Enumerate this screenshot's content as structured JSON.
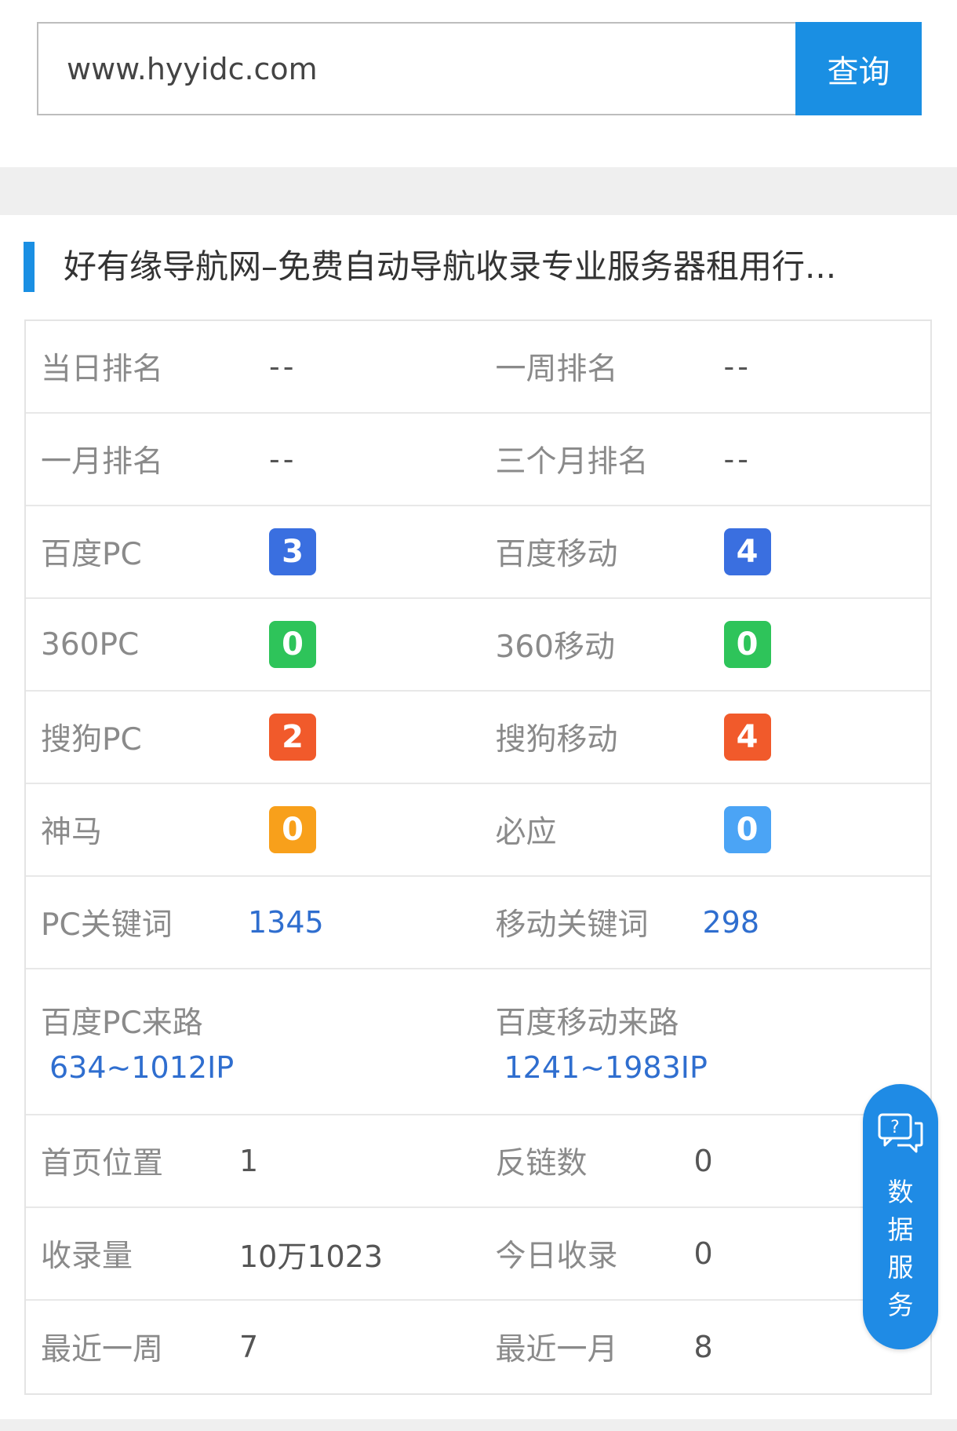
{
  "search": {
    "value": "www.hyyidc.com",
    "button_label": "查询"
  },
  "site_title": "好有缘导航网–免费自动导航收录专业服务器租用行...",
  "colors": {
    "accent": "#1a8fe3",
    "badge_baidu": "#3a6fe0",
    "badge_360": "#2ec45a",
    "badge_sogou": "#f15a2b",
    "badge_shenma": "#f8a01b",
    "badge_bing": "#4ba4f5",
    "value_blue": "#2f6ecf"
  },
  "stats": {
    "rows": [
      {
        "left": {
          "label": "当日排名",
          "value": "--"
        },
        "right": {
          "label": "一周排名",
          "value": "--"
        }
      },
      {
        "left": {
          "label": "一月排名",
          "value": "--"
        },
        "right": {
          "label": "三个月排名",
          "value": "--"
        }
      },
      {
        "left": {
          "label": "百度PC",
          "value": "3",
          "color": "#3a6fe0"
        },
        "right": {
          "label": "百度移动",
          "value": "4",
          "color": "#3a6fe0"
        }
      },
      {
        "left": {
          "label": "360PC",
          "value": "0",
          "color": "#2ec45a"
        },
        "right": {
          "label": "360移动",
          "value": "0",
          "color": "#2ec45a"
        }
      },
      {
        "left": {
          "label": "搜狗PC",
          "value": "2",
          "color": "#f15a2b"
        },
        "right": {
          "label": "搜狗移动",
          "value": "4",
          "color": "#f15a2b"
        }
      },
      {
        "left": {
          "label": "神马",
          "value": "0",
          "color": "#f8a01b"
        },
        "right": {
          "label": "必应",
          "value": "0",
          "color": "#4ba4f5"
        }
      },
      {
        "left": {
          "label": "PC关键词",
          "value": "1345"
        },
        "right": {
          "label": "移动关键词",
          "value": "298"
        }
      },
      {
        "left": {
          "label": "百度PC来路",
          "value": "634~1012IP"
        },
        "right": {
          "label": "百度移动来路",
          "value": "1241~1983IP"
        }
      },
      {
        "left": {
          "label": "首页位置",
          "value": "1"
        },
        "right": {
          "label": "反链数",
          "value": "0"
        }
      },
      {
        "left": {
          "label": "收录量",
          "value": "10万1023"
        },
        "right": {
          "label": "今日收录",
          "value": "0"
        }
      },
      {
        "left": {
          "label": "最近一周",
          "value": "7"
        },
        "right": {
          "label": "最近一月",
          "value": "8"
        }
      }
    ]
  },
  "float_button": {
    "icon": "question-chat-icon",
    "chars": [
      "数",
      "据",
      "服",
      "务"
    ]
  }
}
